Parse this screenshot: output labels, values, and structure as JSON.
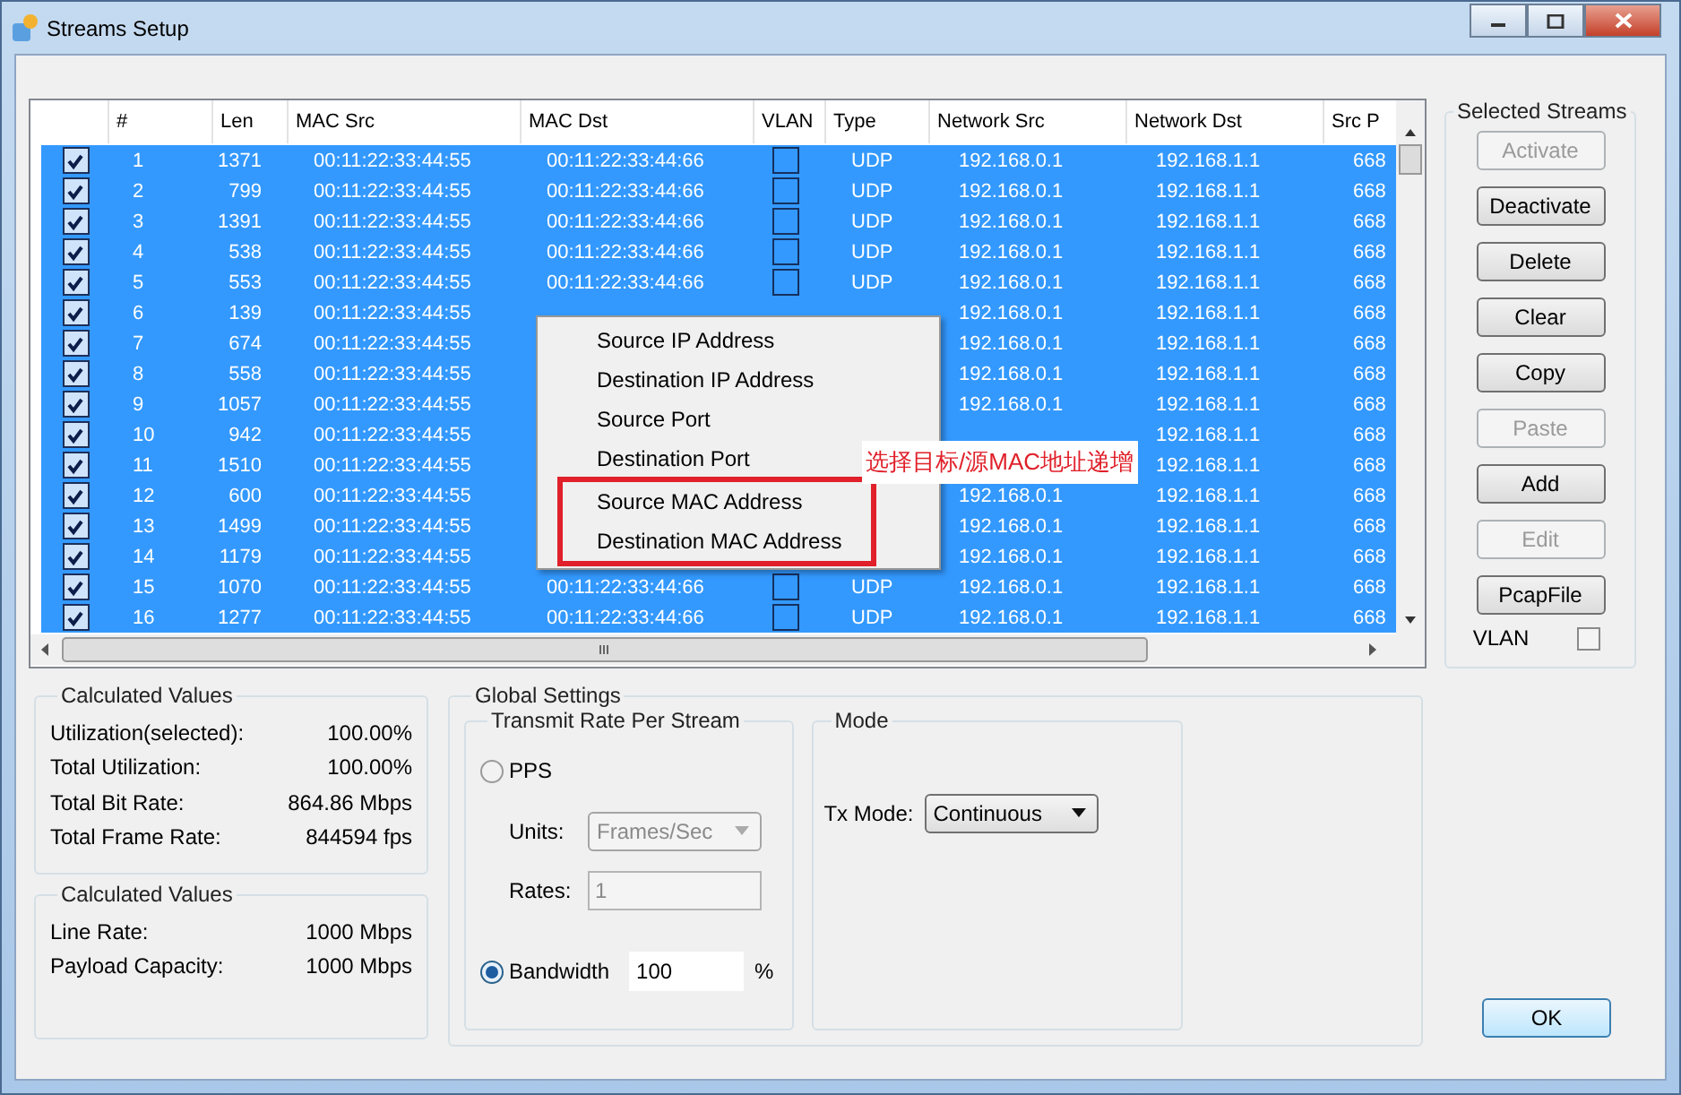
{
  "window": {
    "title": "Streams Setup"
  },
  "table": {
    "columns": [
      "#",
      "Len",
      "MAC Src",
      "MAC Dst",
      "VLAN",
      "Type",
      "Network Src",
      "Network Dst",
      "Src P"
    ],
    "rows": [
      {
        "selected": true,
        "checked": true,
        "number": "1",
        "len": "1371",
        "mac_src": "00:11:22:33:44:55",
        "mac_dst": "00:11:22:33:44:66",
        "vlan": false,
        "type": "UDP",
        "network_src": "192.168.0.1",
        "network_dst": "192.168.1.1",
        "src_port": "668"
      },
      {
        "selected": true,
        "checked": true,
        "number": "2",
        "len": "799",
        "mac_src": "00:11:22:33:44:55",
        "mac_dst": "00:11:22:33:44:66",
        "vlan": false,
        "type": "UDP",
        "network_src": "192.168.0.1",
        "network_dst": "192.168.1.1",
        "src_port": "668"
      },
      {
        "selected": true,
        "checked": true,
        "number": "3",
        "len": "1391",
        "mac_src": "00:11:22:33:44:55",
        "mac_dst": "00:11:22:33:44:66",
        "vlan": false,
        "type": "UDP",
        "network_src": "192.168.0.1",
        "network_dst": "192.168.1.1",
        "src_port": "668"
      },
      {
        "selected": true,
        "checked": true,
        "number": "4",
        "len": "538",
        "mac_src": "00:11:22:33:44:55",
        "mac_dst": "00:11:22:33:44:66",
        "vlan": false,
        "type": "UDP",
        "network_src": "192.168.0.1",
        "network_dst": "192.168.1.1",
        "src_port": "668"
      },
      {
        "selected": true,
        "checked": true,
        "number": "5",
        "len": "553",
        "mac_src": "00:11:22:33:44:55",
        "mac_dst": "00:11:22:33:44:66",
        "vlan": false,
        "type": "UDP",
        "network_src": "192.168.0.1",
        "network_dst": "192.168.1.1",
        "src_port": "668"
      },
      {
        "selected": true,
        "checked": true,
        "number": "6",
        "len": "139",
        "mac_src": "00:11:22:33:44:55",
        "network_src": "192.168.0.1",
        "network_dst": "192.168.1.1",
        "src_port": "668"
      },
      {
        "selected": true,
        "checked": true,
        "number": "7",
        "len": "674",
        "mac_src": "00:11:22:33:44:55",
        "network_src": "192.168.0.1",
        "network_dst": "192.168.1.1",
        "src_port": "668"
      },
      {
        "selected": true,
        "checked": true,
        "number": "8",
        "len": "558",
        "mac_src": "00:11:22:33:44:55",
        "network_src": "192.168.0.1",
        "network_dst": "192.168.1.1",
        "src_port": "668"
      },
      {
        "selected": true,
        "checked": true,
        "number": "9",
        "len": "1057",
        "mac_src": "00:11:22:33:44:55",
        "network_src": "192.168.0.1",
        "network_dst": "192.168.1.1",
        "src_port": "668"
      },
      {
        "selected": true,
        "checked": true,
        "number": "10",
        "len": "942",
        "mac_src": "00:11:22:33:44:55",
        "network_dst": "192.168.1.1",
        "src_port": "668"
      },
      {
        "selected": true,
        "checked": true,
        "number": "11",
        "len": "1510",
        "mac_src": "00:11:22:33:44:55",
        "network_dst": "192.168.1.1",
        "src_port": "668"
      },
      {
        "selected": true,
        "checked": true,
        "number": "12",
        "len": "600",
        "mac_src": "00:11:22:33:44:55",
        "network_src": "192.168.0.1",
        "network_dst": "192.168.1.1",
        "src_port": "668"
      },
      {
        "selected": true,
        "checked": true,
        "number": "13",
        "len": "1499",
        "mac_src": "00:11:22:33:44:55",
        "network_src": "192.168.0.1",
        "network_dst": "192.168.1.1",
        "src_port": "668"
      },
      {
        "selected": true,
        "checked": true,
        "number": "14",
        "len": "1179",
        "mac_src": "00:11:22:33:44:55",
        "network_src": "192.168.0.1",
        "network_dst": "192.168.1.1",
        "src_port": "668"
      },
      {
        "selected": true,
        "checked": true,
        "number": "15",
        "len": "1070",
        "mac_src": "00:11:22:33:44:55",
        "mac_dst": "00:11:22:33:44:66",
        "vlan": false,
        "type": "UDP",
        "network_src": "192.168.0.1",
        "network_dst": "192.168.1.1",
        "src_port": "668"
      },
      {
        "selected": true,
        "checked": true,
        "number": "16",
        "len": "1277",
        "mac_src": "00:11:22:33:44:55",
        "mac_dst": "00:11:22:33:44:66",
        "vlan": false,
        "type": "UDP",
        "network_src": "192.168.0.1",
        "network_dst": "192.168.1.1",
        "src_port": "668"
      }
    ]
  },
  "context_menu": {
    "items": [
      {
        "label": "Source IP Address",
        "boxed": false
      },
      {
        "label": "Destination IP Address",
        "boxed": false
      },
      {
        "label": "Source Port",
        "boxed": false
      },
      {
        "label": "Destination Port",
        "boxed": false
      },
      {
        "label": "Source MAC Address",
        "boxed": true
      },
      {
        "label": "Destination  MAC Address",
        "boxed": true
      }
    ]
  },
  "annotation": {
    "text": "选择目标/源MAC地址递增"
  },
  "selected_streams": {
    "title": "Selected Streams",
    "buttons": [
      {
        "label": "Activate",
        "disabled": true
      },
      {
        "label": "Deactivate",
        "disabled": false
      },
      {
        "label": "Delete",
        "disabled": false
      },
      {
        "label": "Clear",
        "disabled": false
      },
      {
        "label": "Copy",
        "disabled": false
      },
      {
        "label": "Paste",
        "disabled": true
      },
      {
        "label": "Add",
        "disabled": false
      },
      {
        "label": "Edit",
        "disabled": true
      },
      {
        "label": "PcapFile",
        "disabled": false
      }
    ],
    "vlan": {
      "label": "VLAN",
      "checked": false
    }
  },
  "calculated_values": [
    {
      "title": "Calculated Values",
      "rows": [
        {
          "label": "Utilization(selected):",
          "value": "100.00%"
        },
        {
          "label": "Total Utilization:",
          "value": "100.00%"
        },
        {
          "label": "Total Bit Rate:",
          "value": "864.86 Mbps"
        },
        {
          "label": "Total Frame Rate:",
          "value": "844594 fps"
        }
      ]
    },
    {
      "title": "Calculated Values",
      "rows": [
        {
          "label": "Line Rate:",
          "value": "1000 Mbps"
        },
        {
          "label": "Payload Capacity:",
          "value": "1000 Mbps"
        }
      ]
    }
  ],
  "global_settings": {
    "title": "Global Settings",
    "transmit_rate": {
      "title": "Transmit Rate Per Stream",
      "pps": {
        "label": "PPS",
        "selected": false
      },
      "units": {
        "label": "Units:",
        "value": "Frames/Sec",
        "disabled": true
      },
      "rates": {
        "label": "Rates:",
        "value": "1",
        "disabled": true
      },
      "bandwidth": {
        "label": "Bandwidth",
        "selected": true,
        "value": "100",
        "unit": "%"
      }
    },
    "mode": {
      "title": "Mode",
      "tx_mode": {
        "label": "Tx Mode:",
        "value": "Continuous"
      }
    }
  },
  "ok_button": {
    "label": "OK"
  }
}
